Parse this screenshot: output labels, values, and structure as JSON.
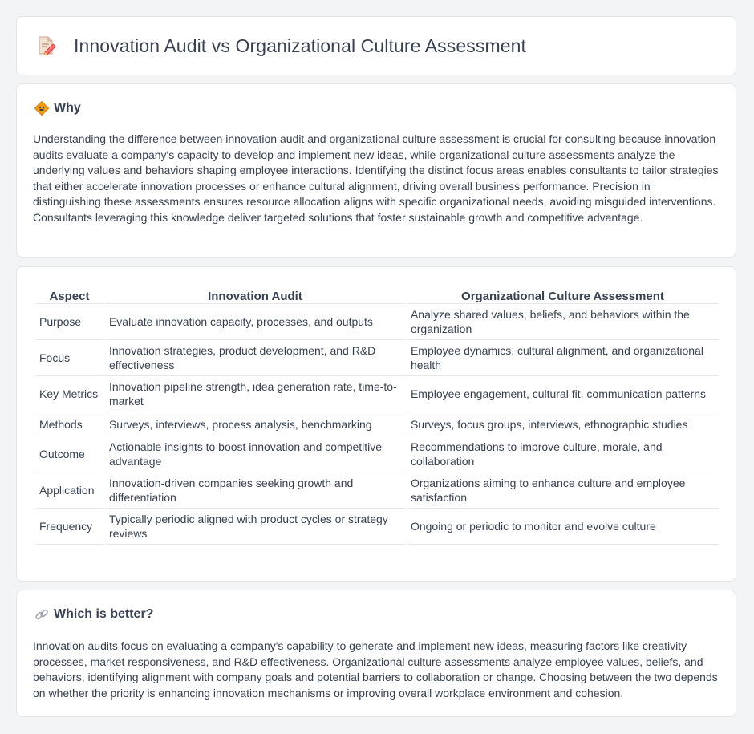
{
  "header": {
    "title": "Innovation Audit vs Organizational Culture Assessment",
    "icon": "document-pencil-icon"
  },
  "why": {
    "heading": "Why",
    "icon": "diamond-sign-icon",
    "text": "Understanding the difference between innovation audit and organizational culture assessment is crucial for consulting because innovation audits evaluate a company's capacity to develop and implement new ideas, while organizational culture assessments analyze the underlying values and behaviors shaping employee interactions. Identifying the distinct focus areas enables consultants to tailor strategies that either accelerate innovation processes or enhance cultural alignment, driving overall business performance. Precision in distinguishing these assessments ensures resource allocation aligns with specific organizational needs, avoiding misguided interventions. Consultants leveraging this knowledge deliver targeted solutions that foster sustainable growth and competitive advantage."
  },
  "table": {
    "headers": [
      "Aspect",
      "Innovation Audit",
      "Organizational Culture Assessment"
    ],
    "rows": [
      [
        "Purpose",
        "Evaluate innovation capacity, processes, and outputs",
        "Analyze shared values, beliefs, and behaviors within the organization"
      ],
      [
        "Focus",
        "Innovation strategies, product development, and R&D effectiveness",
        "Employee dynamics, cultural alignment, and organizational health"
      ],
      [
        "Key Metrics",
        "Innovation pipeline strength, idea generation rate, time-to-market",
        "Employee engagement, cultural fit, communication patterns"
      ],
      [
        "Methods",
        "Surveys, interviews, process analysis, benchmarking",
        "Surveys, focus groups, interviews, ethnographic studies"
      ],
      [
        "Outcome",
        "Actionable insights to boost innovation and competitive advantage",
        "Recommendations to improve culture, morale, and collaboration"
      ],
      [
        "Application",
        "Innovation-driven companies seeking growth and differentiation",
        "Organizations aiming to enhance culture and employee satisfaction"
      ],
      [
        "Frequency",
        "Typically periodic aligned with product cycles or strategy reviews",
        "Ongoing or periodic to monitor and evolve culture"
      ]
    ]
  },
  "better": {
    "heading": "Which is better?",
    "icon": "link-icon",
    "text": "Innovation audits focus on evaluating a company's capability to generate and implement new ideas, measuring factors like creativity processes, market responsiveness, and R&D effectiveness. Organizational culture assessments analyze employee values, beliefs, and behaviors, identifying alignment with company goals and potential barriers to collaboration or change. Choosing between the two depends on whether the priority is enhancing innovation mechanisms or improving overall workplace environment and cohesion."
  },
  "colors": {
    "background": "#f3f4f6",
    "card": "#ffffff",
    "text": "#374151",
    "border": "#e5e7eb",
    "icon_orange": "#f59e0b",
    "icon_pink": "#f87171"
  }
}
